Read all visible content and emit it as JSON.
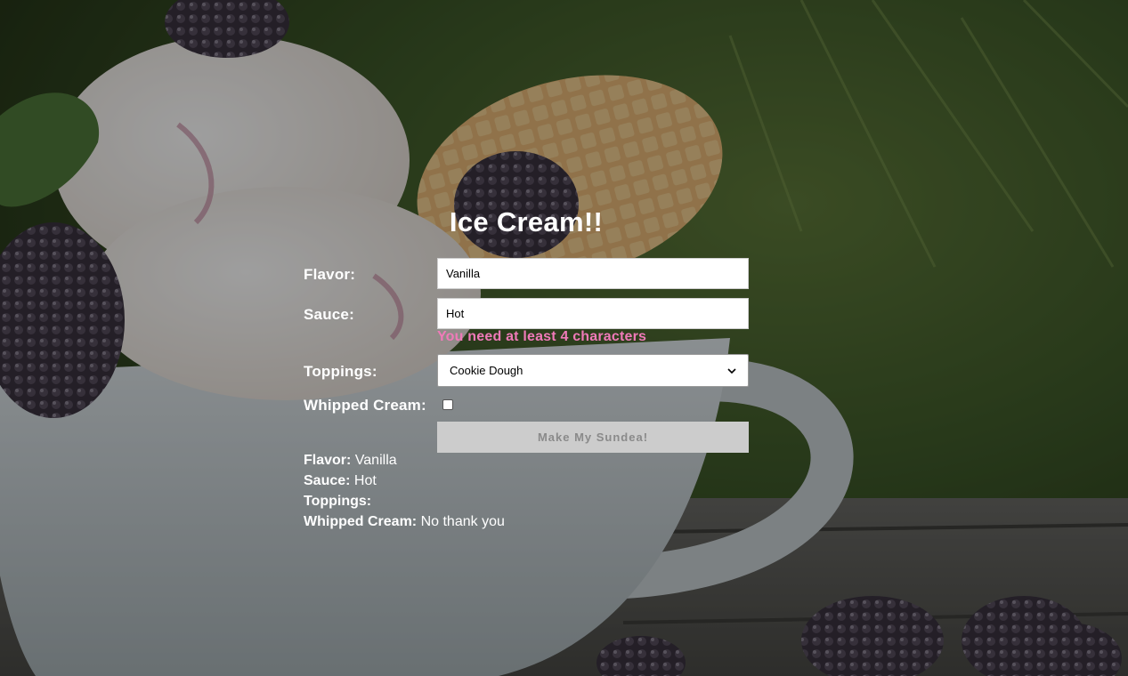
{
  "title": "Ice Cream!!",
  "form": {
    "flavor": {
      "label": "Flavor:",
      "value": "Vanilla"
    },
    "sauce": {
      "label": "Sauce:",
      "value": "Hot",
      "error": "You need at least 4 characters"
    },
    "toppings": {
      "label": "Toppings:",
      "selected": "Cookie Dough"
    },
    "whipped_cream": {
      "label": "Whipped Cream:",
      "checked": false
    },
    "submit_label": "Make My Sundea!"
  },
  "summary": {
    "flavor_label": "Flavor:",
    "flavor_value": "Vanilla",
    "sauce_label": "Sauce:",
    "sauce_value": "Hot",
    "toppings_label": "Toppings:",
    "toppings_value": "",
    "whipped_label": "Whipped Cream:",
    "whipped_value": "No thank you"
  },
  "colors": {
    "error": "#f07ab9",
    "button_bg": "#cccccc",
    "button_text": "#8a8a8a"
  }
}
